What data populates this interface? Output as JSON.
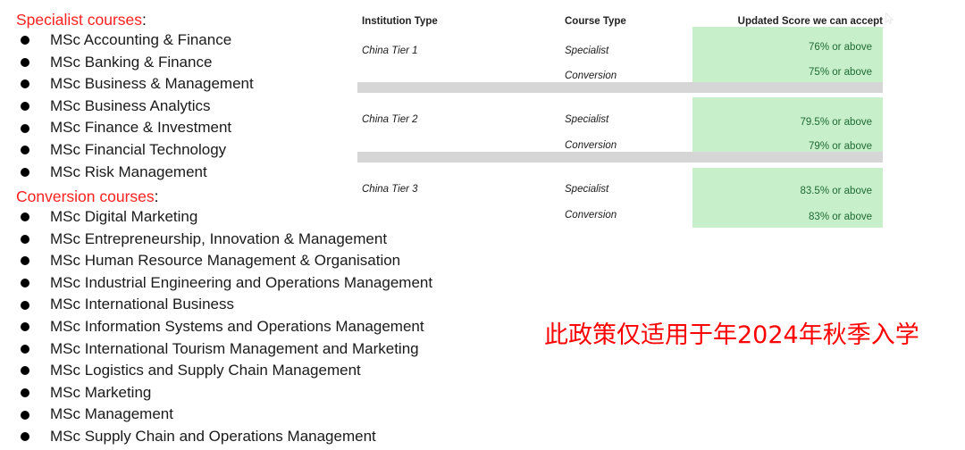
{
  "course_lists": [
    {
      "heading": "Specialist courses",
      "heading_colon": ":",
      "items": [
        "MSc Accounting & Finance",
        "MSc Banking & Finance",
        "MSc Business & Management",
        "MSc Business Analytics",
        "MSc Finance & Investment",
        "MSc Financial Technology",
        "MSc Risk Management"
      ]
    },
    {
      "heading": "Conversion courses",
      "heading_colon": ":",
      "items": [
        "MSc Digital Marketing",
        "MSc Entrepreneurship, Innovation & Management",
        "MSc Human Resource Management & Organisation",
        "MSc Industrial Engineering and Operations Management",
        "MSc International Business",
        "MSc Information Systems and Operations Management",
        "MSc International Tourism Management and Marketing",
        "MSc Logistics and Supply Chain Management",
        "MSc Marketing",
        "MSc Management",
        "MSc Supply Chain and Operations Management"
      ]
    }
  ],
  "table": {
    "headers": {
      "institution_type": "Institution Type",
      "course_type": "Course Type",
      "score": "Updated Score we can accept"
    },
    "rows": [
      {
        "institution": "China Tier 1",
        "course_type": "Specialist",
        "score": "76% or above"
      },
      {
        "institution": "",
        "course_type": "Conversion",
        "score": "75% or above"
      },
      {
        "institution": "China Tier 2",
        "course_type": "Specialist",
        "score": "79.5% or above"
      },
      {
        "institution": "",
        "course_type": "Conversion",
        "score": "79% or above"
      },
      {
        "institution": "China Tier 3",
        "course_type": "Specialist",
        "score": "83.5% or above"
      },
      {
        "institution": "",
        "course_type": "Conversion",
        "score": "83% or above"
      }
    ]
  },
  "policy_note": "此政策仅适用于年2024年秋季入学",
  "colors": {
    "heading_red": "#ff2020",
    "note_red": "#fe0000",
    "score_highlight_green": "#c7efca",
    "score_text_green": "#1f6b33",
    "separator_grey": "#d6d6d6",
    "body_text": "#1a1a1a"
  }
}
